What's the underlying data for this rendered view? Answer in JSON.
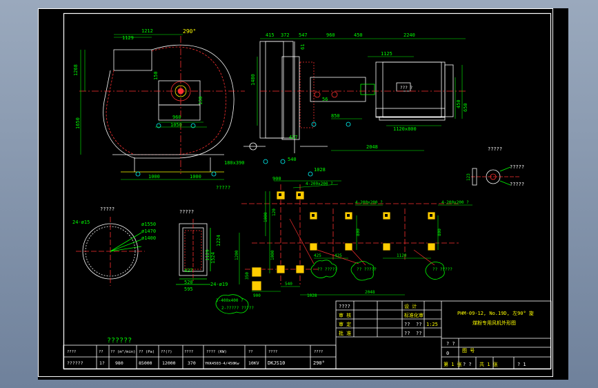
{
  "colors": {
    "background": "#000000",
    "frame": "#ffffff",
    "dimension": "#00ff00",
    "geometry": "#ffffff",
    "centerline": "#ff2020",
    "yellow": "#ffff00",
    "foundation": "#ffcc00"
  },
  "view_side": {
    "angle": "290°",
    "dims_top": [
      "1129",
      "1212"
    ],
    "dims_left": [
      "1268",
      "1650"
    ],
    "dims_bottom": [
      "1000",
      "1000"
    ],
    "dims_base": [
      "960",
      "1050"
    ],
    "dim_150": "150",
    "dim_130": "130",
    "dim_180x390": "180x390",
    "label_bottom": "?????"
  },
  "view_front": {
    "dims_top": [
      "415",
      "372",
      "547",
      "960",
      "450",
      "2240"
    ],
    "dim_1125": "1125",
    "dim_1480": "1480",
    "dim_61": "61",
    "dim_56": "56",
    "dim_850": "850",
    "dim_427": "427",
    "dim_540": "540",
    "dim_900": "900",
    "dim_1028": "1028",
    "dim_2048": "2048",
    "dim_450": "450",
    "dim_650": "650",
    "dim_1120x800": "1120x800",
    "motor_label": "??? ?"
  },
  "view_circle": {
    "title": "?????",
    "dim_24": "24-ø15",
    "dims_d": [
      "ø1550",
      "ø1470",
      "ø1400"
    ]
  },
  "view_rect": {
    "title": "?????",
    "dims_side": [
      "1129",
      "1524",
      "1224"
    ],
    "dims_bottom": [
      "427",
      "520",
      "595"
    ],
    "dim_24": "24-ø19"
  },
  "view_detail": {
    "title": "?????",
    "labels": [
      "?????",
      "?????"
    ],
    "dim_123": "123"
  },
  "view_foundation": {
    "dims_left": [
      "1000",
      "1000",
      "1200"
    ],
    "dims_bottom": [
      "900",
      "540",
      "1028",
      "2048"
    ],
    "dims_inner": [
      "425",
      "425",
      "800",
      "1120",
      "800"
    ],
    "dim_hole1": "4-200x200 ?",
    "dim_hole2": "4-200x200 ?",
    "dim_hole3": "4-200x200 ?",
    "dim_hole4": "2-400x400 ?",
    "dim_350": "350",
    "dim_120": "120",
    "bubbles": [
      "??\n?????",
      "??\n?????",
      "??\n?????",
      "??\n?????"
    ],
    "bubble_bottom": "2-?????\n?????"
  },
  "titleblock": {
    "project_line1": "PHM-09-12, No.19D, 左90° 旋",
    "project_line2": "煤粉专用风机外形图",
    "rows": [
      [
        "????",
        "",
        "",
        "",
        "设 计",
        ""
      ],
      [
        "审 核",
        "",
        "",
        "",
        "标准化审",
        ""
      ],
      [
        "审 定",
        "",
        "",
        "",
        "??",
        "??",
        "1:25"
      ],
      [
        "批 准",
        "",
        "",
        "",
        "??",
        "??"
      ]
    ],
    "drawing_no": "图 号",
    "sheet_label": "第 1 张",
    "sheet_total": "共 1 张",
    "q": "? ?",
    "weight": "? ?",
    "zero": "0",
    "total": "? 1"
  },
  "spec_table": {
    "title": "??????",
    "headers": [
      "????",
      "??",
      "?? (m³/min)",
      "?? (Pa)",
      "??(?)",
      "????",
      "????  (KW)",
      "??",
      "????",
      "????"
    ],
    "values": [
      "??????",
      "1?",
      "980",
      "85000",
      "12000",
      "370",
      "YKK4503-4/450Kw",
      "10KV",
      "DKJS10",
      "290°"
    ]
  }
}
